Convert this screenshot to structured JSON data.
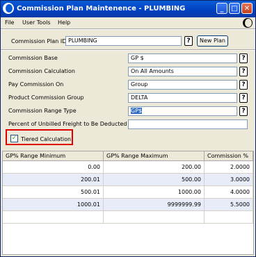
{
  "window": {
    "title": "Commission Plan Maintenence - PLUMBING"
  },
  "title_buttons": {
    "minimize": "_",
    "maximize": "□",
    "close": "✕"
  },
  "menu": [
    "File",
    "User Tools",
    "Help"
  ],
  "header": {
    "plan_id_label": "Commission Plan ID",
    "plan_id_value": "PLUMBING",
    "lookup_glyph": "?",
    "new_plan_label": "New Plan"
  },
  "form": {
    "commission_base": {
      "label": "Commission Base",
      "value": "GP $"
    },
    "commission_calculation": {
      "label": "Commission Calculation",
      "value": "On All Amounts"
    },
    "pay_commission_on": {
      "label": "Pay Commission On",
      "value": "Group"
    },
    "product_commission_group": {
      "label": "Product Commission Group",
      "value": "DELTA"
    },
    "commission_range_type": {
      "label": "Commission Range Type",
      "value": "GP$"
    },
    "unbilled_freight": {
      "label": "Percent of Unbilled Freight to Be Deducted",
      "value": ""
    },
    "tiered_calculation": {
      "label": "Tiered Calculation",
      "checked": true,
      "check_glyph": "✓"
    }
  },
  "grid": {
    "columns": [
      "GP% Range Minimum",
      "GP% Range Maximum",
      "Commission %"
    ],
    "rows": [
      [
        "0.00",
        "200.00",
        "2.0000"
      ],
      [
        "200.01",
        "500.00",
        "3.0000"
      ],
      [
        "500.01",
        "1000.00",
        "4.0000"
      ],
      [
        "1000.01",
        "9999999.99",
        "5.5000"
      ],
      [
        "",
        "",
        ""
      ]
    ]
  },
  "colors": {
    "titlebar": "#0040c0",
    "highlight_border": "#e00000",
    "selection": "#316ac5"
  }
}
